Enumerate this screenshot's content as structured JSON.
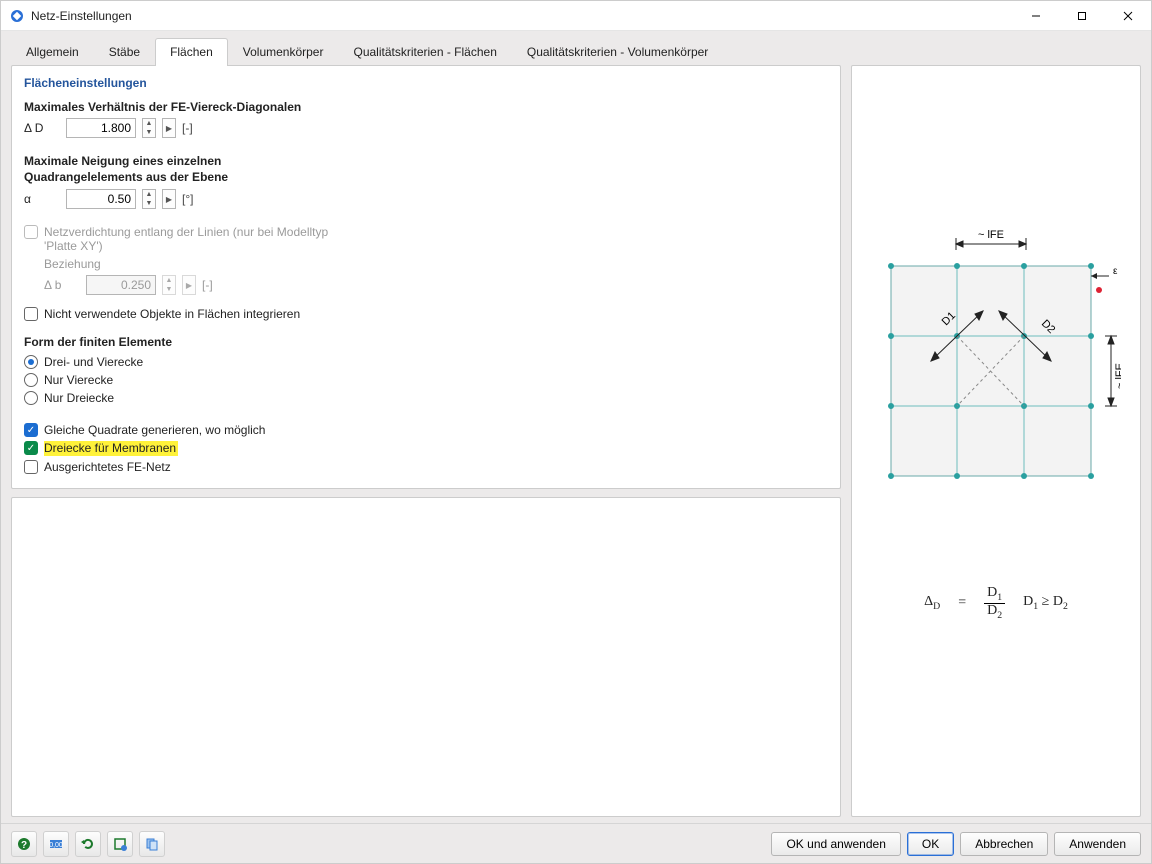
{
  "window": {
    "title": "Netz-Einstellungen"
  },
  "tabs": [
    "Allgemein",
    "Stäbe",
    "Flächen",
    "Volumenkörper",
    "Qualitätskriterien - Flächen",
    "Qualitätskriterien - Volumenkörper"
  ],
  "active_tab": 2,
  "section": {
    "heading": "Flächeneinstellungen",
    "ratio_label": "Maximales Verhältnis der FE-Viereck-Diagonalen",
    "ratio_symbol": "Δ D",
    "ratio_value": "1.800",
    "ratio_unit": "[-]",
    "incl_label_l1": "Maximale Neigung eines einzelnen",
    "incl_label_l2": "Quadrangelelements aus der Ebene",
    "incl_symbol": "α",
    "incl_value": "0.50",
    "incl_unit": "[°]",
    "refine_lines": "Netzverdichtung entlang der Linien (nur bei Modelltyp 'Platte XY')",
    "relation_label": "Beziehung",
    "relation_symbol": "Δ b",
    "relation_value": "0.250",
    "relation_unit": "[-]",
    "integrate_unused": "Nicht verwendete Objekte in Flächen integrieren",
    "shape_heading": "Form der finiten Elemente",
    "shape_options": [
      "Drei- und Vierecke",
      "Nur Vierecke",
      "Nur Dreiecke"
    ],
    "shape_selected": 0,
    "equal_squares": "Gleiche Quadrate generieren, wo möglich",
    "triangles_membranes": "Dreiecke für Membranen",
    "mapped_mesh": "Ausgerichtetes FE-Netz"
  },
  "diagram": {
    "lfe_top": "~ lFE",
    "lfe_right": "~ lFE",
    "d1": "D1",
    "d2": "D2",
    "eps": "ε"
  },
  "formula": {
    "lhs": "ΔD",
    "eq": "=",
    "num": "D1",
    "den": "D2",
    "cond": "D1 ≥ D2"
  },
  "buttons": {
    "ok_apply": "OK und anwenden",
    "ok": "OK",
    "cancel": "Abbrechen",
    "apply": "Anwenden"
  }
}
